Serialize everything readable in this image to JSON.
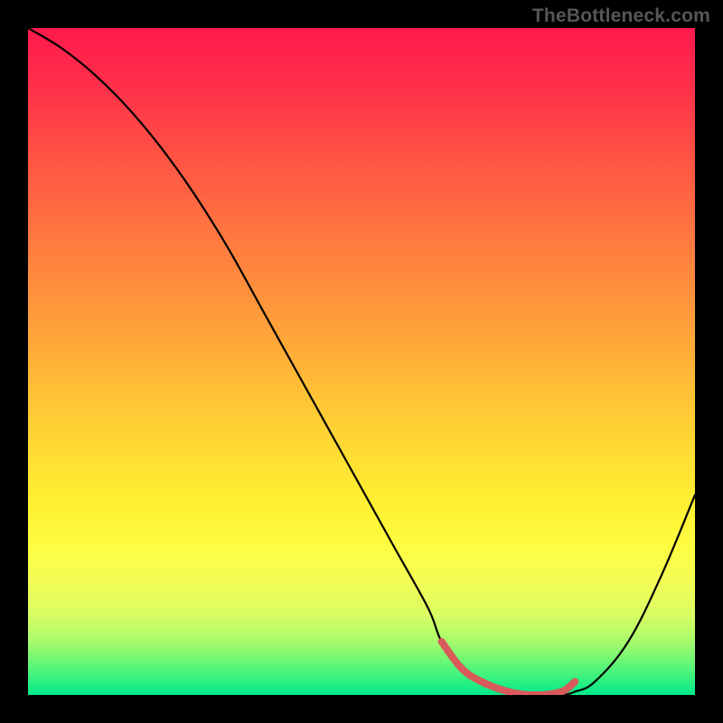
{
  "watermark": "TheBottleneck.com",
  "chart_data": {
    "type": "line",
    "title": "",
    "xlabel": "",
    "ylabel": "",
    "xlim": [
      0,
      100
    ],
    "ylim": [
      0,
      100
    ],
    "series": [
      {
        "name": "bottleneck-curve",
        "x": [
          0,
          5,
          10,
          15,
          20,
          25,
          30,
          35,
          40,
          45,
          50,
          55,
          60,
          62,
          65,
          68,
          72,
          76,
          80,
          82,
          85,
          90,
          95,
          100
        ],
        "y": [
          100,
          97,
          93,
          88,
          82,
          75,
          67,
          58,
          49,
          40,
          31,
          22,
          13,
          8,
          4,
          2,
          0.5,
          0,
          0,
          0.5,
          2,
          8,
          18,
          30
        ]
      },
      {
        "name": "highlight-segment",
        "x": [
          62,
          65,
          68,
          72,
          76,
          80,
          82
        ],
        "y": [
          8,
          4,
          2,
          0.5,
          0,
          0.5,
          2
        ]
      }
    ],
    "gradient_stops": [
      {
        "pos": 0,
        "color": "#ff1a4d"
      },
      {
        "pos": 50,
        "color": "#ffc236"
      },
      {
        "pos": 80,
        "color": "#fdfd42"
      },
      {
        "pos": 100,
        "color": "#00e98a"
      }
    ]
  }
}
